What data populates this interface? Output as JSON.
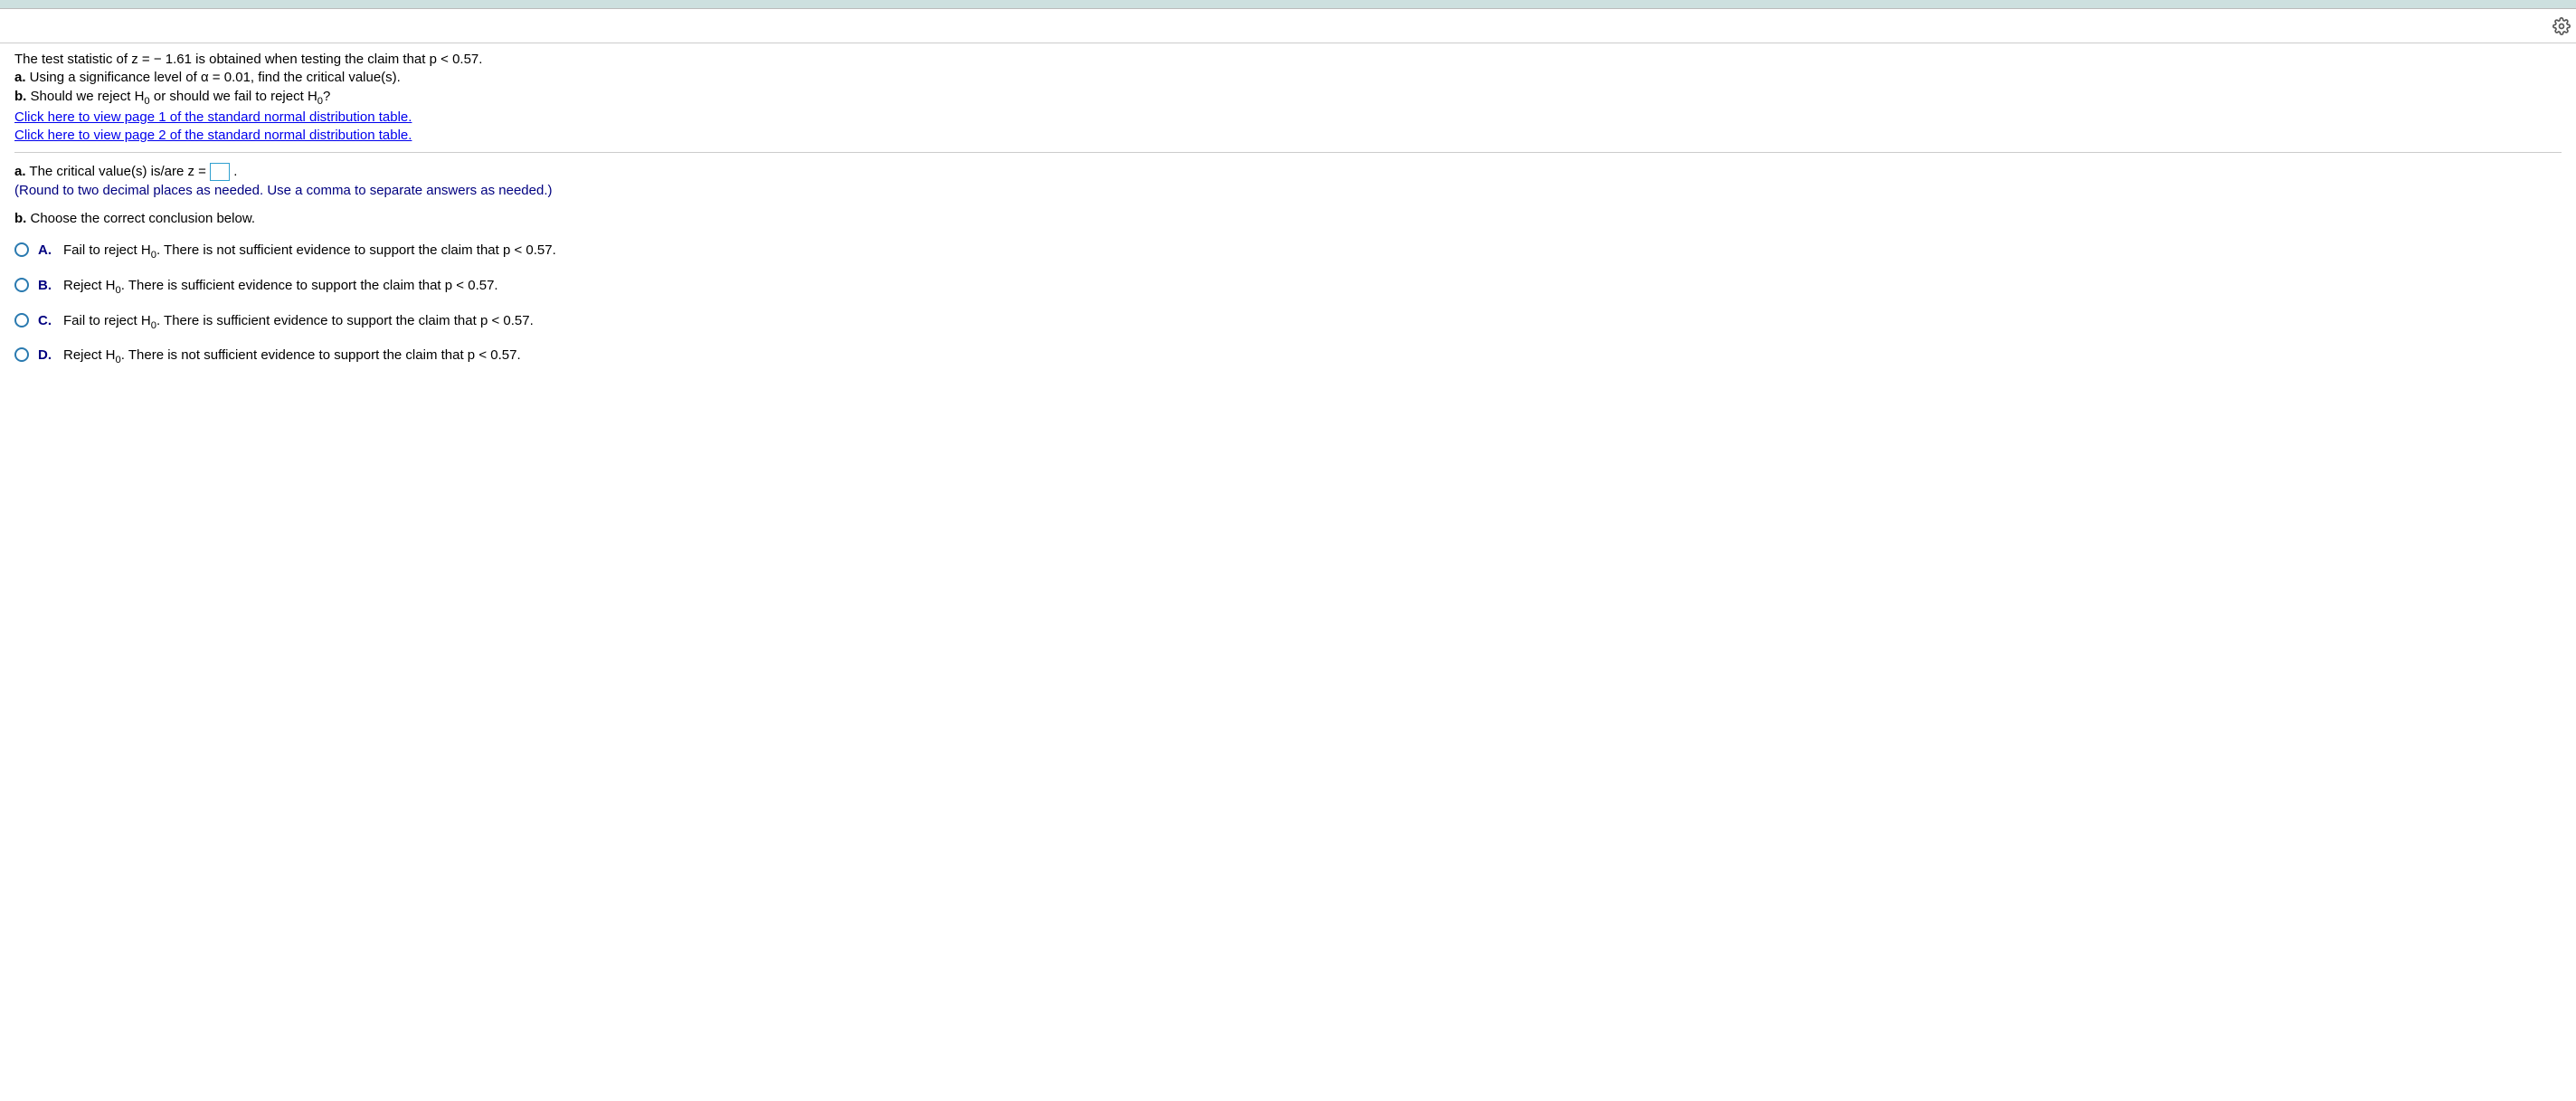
{
  "problem": {
    "line1_pre": "The test statistic of z",
    "line1_mid": "=",
    "line1_neg": " − 1.61",
    "line1_post": " is obtained when testing the claim that p",
    "line1_lt": "<",
    "line1_val": "0.57.",
    "a_label": "a.",
    "a_text_pre": " Using a significance level of α",
    "a_eq": "=",
    "a_alpha": "0.01,",
    "a_text_post": " find the critical value(s).",
    "b_label": "b.",
    "b_text_pre": " Should we reject H",
    "b_sub": "0",
    "b_text_mid": " or should we fail to reject H",
    "b_sub2": "0",
    "b_text_end": "?",
    "link1": "Click here to view page 1 of the standard normal distribution table.",
    "link2": "Click here to view page 2 of the standard normal distribution table."
  },
  "answer_a": {
    "label": "a.",
    "text_pre": " The critical value(s) is/are z",
    "eq": "=",
    "period": ".",
    "hint": "(Round to two decimal places as needed. Use a comma to separate answers as needed.)"
  },
  "answer_b": {
    "label": "b.",
    "prompt": " Choose the correct conclusion below."
  },
  "options": [
    {
      "letter": "A.",
      "pre": "Fail to reject H",
      "sub": "0",
      "post": ". There is not sufficient evidence to support the claim that p",
      "lt": "<",
      "val": "0.57."
    },
    {
      "letter": "B.",
      "pre": "Reject H",
      "sub": "0",
      "post": ". There is sufficient evidence to support the claim that p",
      "lt": "<",
      "val": "0.57."
    },
    {
      "letter": "C.",
      "pre": "Fail to reject H",
      "sub": "0",
      "post": ". There is sufficient evidence to support the claim that p",
      "lt": "<",
      "val": "0.57."
    },
    {
      "letter": "D.",
      "pre": "Reject H",
      "sub": "0",
      "post": ". There is not sufficient evidence to support the claim that p",
      "lt": "<",
      "val": "0.57."
    }
  ]
}
